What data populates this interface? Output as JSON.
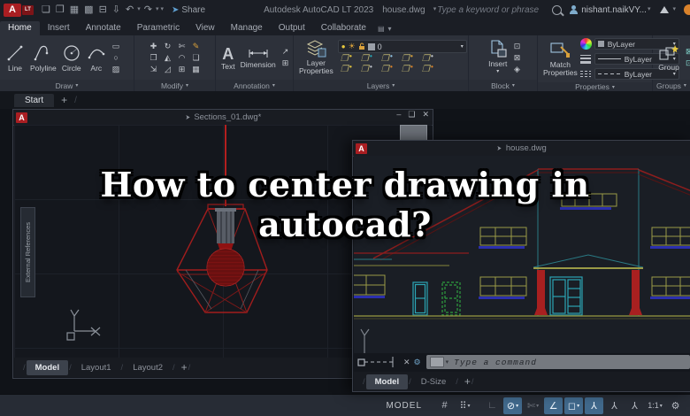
{
  "window": {
    "app_title": "Autodesk AutoCAD LT 2023",
    "doc_title": "house.dwg"
  },
  "titlebar": {
    "logo_a": "A",
    "logo_lt": "LT",
    "share": "Share",
    "search_placeholder": "Type a keyword or phrase",
    "user": "nishant.naikVY..."
  },
  "ribbon": {
    "tabs": [
      {
        "label": "Home"
      },
      {
        "label": "Insert"
      },
      {
        "label": "Annotate"
      },
      {
        "label": "Parametric"
      },
      {
        "label": "View"
      },
      {
        "label": "Manage"
      },
      {
        "label": "Output"
      },
      {
        "label": "Collaborate"
      }
    ],
    "active_tab": "Home",
    "draw": {
      "label": "Draw",
      "tools": [
        {
          "label": "Line"
        },
        {
          "label": "Polyline"
        },
        {
          "label": "Circle"
        },
        {
          "label": "Arc"
        }
      ]
    },
    "modify": {
      "label": "Modify"
    },
    "annotation": {
      "label": "Annotation",
      "big_a": "A",
      "text": "Text",
      "dimension": "Dimension"
    },
    "layers": {
      "label": "Layers",
      "big": "Layer Properties",
      "current_layer": "0"
    },
    "block": {
      "label": "Block",
      "insert": "Insert"
    },
    "properties": {
      "label": "Properties",
      "match": "Match Properties",
      "color": "ByLayer",
      "lineweight": "ByLayer",
      "linetype": "ByLayer"
    },
    "groups": {
      "label": "Groups",
      "group": "Group"
    }
  },
  "file_tabs": {
    "start": "Start",
    "add": "+"
  },
  "sections_window": {
    "title": "Sections_01.dwg*",
    "palette": "External References",
    "tabs": [
      {
        "label": "Model"
      },
      {
        "label": "Layout1"
      },
      {
        "label": "Layout2"
      }
    ],
    "active_tab": "Model",
    "add": "+"
  },
  "house_window": {
    "title": "house.dwg",
    "command_placeholder": "Type a command",
    "tabs": [
      {
        "label": "Model"
      },
      {
        "label": "D-Size"
      }
    ],
    "active_tab": "Model",
    "add": "+"
  },
  "overlay": {
    "line1": "How to center drawing in",
    "line2": "autocad?"
  },
  "statusbar": {
    "model": "MODEL",
    "scale": "1:1"
  },
  "icons": {
    "qat_new": "❏",
    "qat_open": "❒",
    "qat_save": "▦",
    "qat_saveas": "▩",
    "qat_plot": "⊟",
    "qat_export": "⇩",
    "undo": "↶",
    "redo": "↷",
    "caret": "▾",
    "share_plane": "➤",
    "pin": "➤",
    "minimize": "–",
    "maximize": "❑",
    "close": "✕",
    "plus": "+",
    "slash": "/",
    "ribbon_display": "▤",
    "sun": "☀",
    "bulb": "●",
    "modify": [
      "✚",
      "↻",
      "✄",
      "✎",
      "❐",
      "◭",
      "◠",
      "❏",
      "⇲",
      "◿",
      "⊞",
      "▦"
    ],
    "leader": "↗",
    "table": "⊞",
    "block_small": [
      "⊡",
      "⊠",
      "◈"
    ],
    "draw_small": [
      "▭",
      "○",
      "▨"
    ],
    "grid": "#",
    "snap": "⠿",
    "ortho": "∟",
    "polar": "⊘",
    "isodraft": "✄",
    "otrack": "∠",
    "osnap": "◻",
    "annot": "⅄",
    "gear": "⚙",
    "cmd_close": "✕",
    "cmd_wrench": "⚙"
  },
  "colors": {
    "accent_red": "#a91e22",
    "lamp_red": "#a11d1d",
    "olive": "#85853c",
    "sill_blue": "#2b2fae",
    "door_cyan": "#2ba4b4",
    "door_green": "#2f9e3f",
    "roof_red": "#8e1d1d",
    "column_red": "#a82020",
    "highlight_blue": "#41698c"
  }
}
